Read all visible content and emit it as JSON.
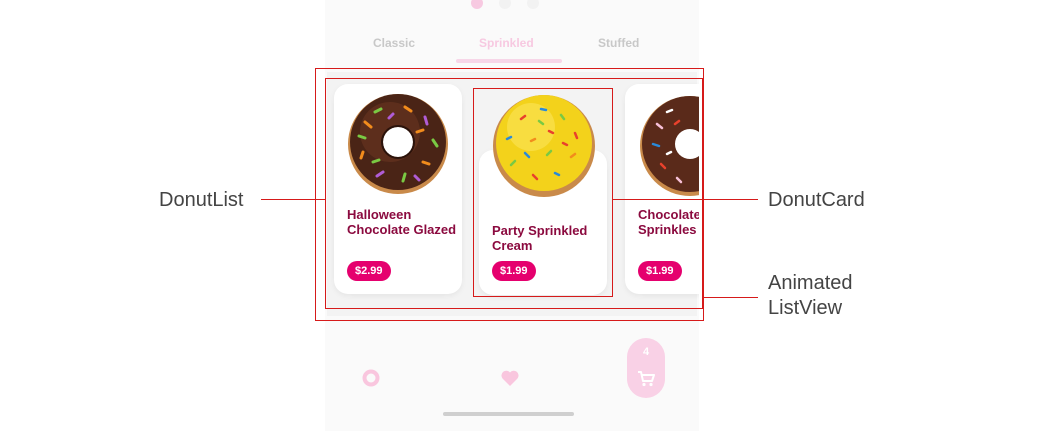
{
  "tabs": [
    "Classic",
    "Sprinkled",
    "Stuffed"
  ],
  "cards": [
    {
      "name": "Halloween Chocolate Glazed",
      "price": "$2.99"
    },
    {
      "name": "Party Sprinkled Cream",
      "price": "$1.99"
    },
    {
      "name": "Chocolate Glazed Sprinkles",
      "price": "$1.99"
    }
  ],
  "cart_count": "4",
  "annotations": {
    "donut_list": "DonutList",
    "donut_card": "DonutCard",
    "animated_list_view": "Animated ListView"
  },
  "colors": {
    "accent": "#e5006e",
    "name_text": "#8b0a3f",
    "annotation_line": "#d61a1a"
  },
  "icons": [
    "donut-icon",
    "heart-icon",
    "cart-icon"
  ]
}
